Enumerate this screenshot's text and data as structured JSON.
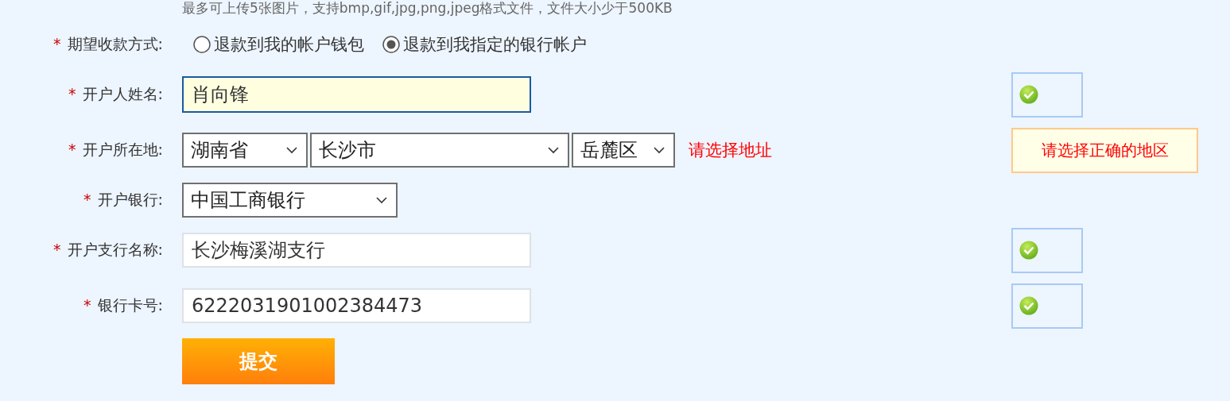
{
  "hint": "最多可上传5张图片，支持bmp,gif,jpg,png,jpeg格式文件，文件大小少于500KB",
  "rows": [
    {
      "kind": "radio",
      "mark": "*",
      "label": "期望收款方式:",
      "options": [
        {
          "label": "退款到我的帐户钱包",
          "selected": false
        },
        {
          "label": "退款到我指定的银行帐户",
          "selected": true
        }
      ]
    },
    {
      "kind": "text",
      "mark": "*",
      "label": "开户人姓名:",
      "value": "肖向锋",
      "focused": true,
      "status": {
        "kind": "ok"
      }
    },
    {
      "kind": "selects",
      "mark": "*",
      "label": "开户所在地:",
      "selects": [
        "湖南省",
        "长沙市",
        "岳麓区"
      ],
      "note": "请选择地址",
      "status": {
        "kind": "error",
        "text": "请选择正确的地区"
      }
    },
    {
      "kind": "select",
      "mark": "*",
      "label": "开户银行:",
      "selects": [
        "中国工商银行"
      ]
    },
    {
      "kind": "text",
      "mark": "*",
      "label": "开户支行名称:",
      "value": "长沙梅溪湖支行",
      "focused": false,
      "status": {
        "kind": "ok"
      }
    },
    {
      "kind": "text",
      "mark": "*",
      "label": "银行卡号:",
      "value": "6222031901002384473",
      "focused": false,
      "status": {
        "kind": "ok"
      }
    },
    {
      "kind": "button",
      "label": "提交"
    }
  ]
}
